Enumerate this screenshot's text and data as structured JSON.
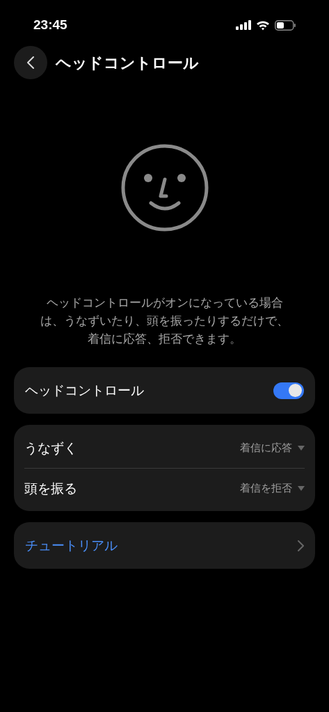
{
  "status_bar": {
    "time": "23:45"
  },
  "header": {
    "title": "ヘッドコントロール"
  },
  "description_lines": [
    "ヘッドコントロールがオンになっている場合",
    "は、うなずいたり、頭を振ったりするだけで、",
    "着信に応答、拒否できます。"
  ],
  "toggle_row": {
    "label": "ヘッドコントロール",
    "on": true
  },
  "gestures": [
    {
      "label": "うなずく",
      "value": "着信に応答"
    },
    {
      "label": "頭を振る",
      "value": "着信を拒否"
    }
  ],
  "tutorial": {
    "label": "チュートリアル"
  }
}
